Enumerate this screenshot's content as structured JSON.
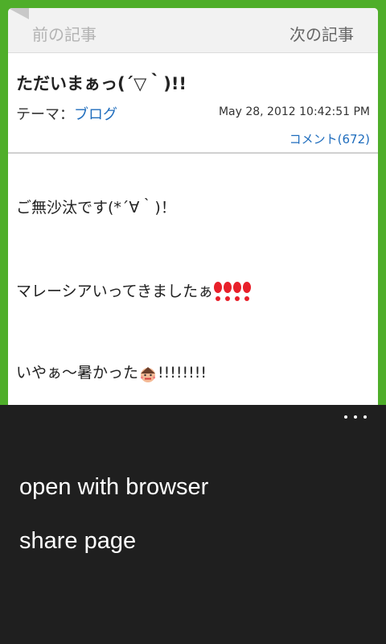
{
  "nav": {
    "prev_label": "前の記事",
    "next_label": "次の記事"
  },
  "article": {
    "title": "ただいまぁっ(´▽｀)!!",
    "theme_label": "テーマ：",
    "theme_value": "ブログ",
    "timestamp": "May 28, 2012 10:42:51 PM",
    "comments": "コメント(672)",
    "paragraphs": [
      "ご無沙汰です(*´∀｀)！",
      "マレーシアいってきましたぁ",
      "いやぁ～暑かった",
      "!!!!!!!!"
    ]
  },
  "menu": {
    "items": [
      "open with browser",
      "share page"
    ]
  },
  "colors": {
    "accent_green": "#4fae2a",
    "link_blue": "#1f6dbd",
    "menu_bg": "#1f1f1f"
  }
}
